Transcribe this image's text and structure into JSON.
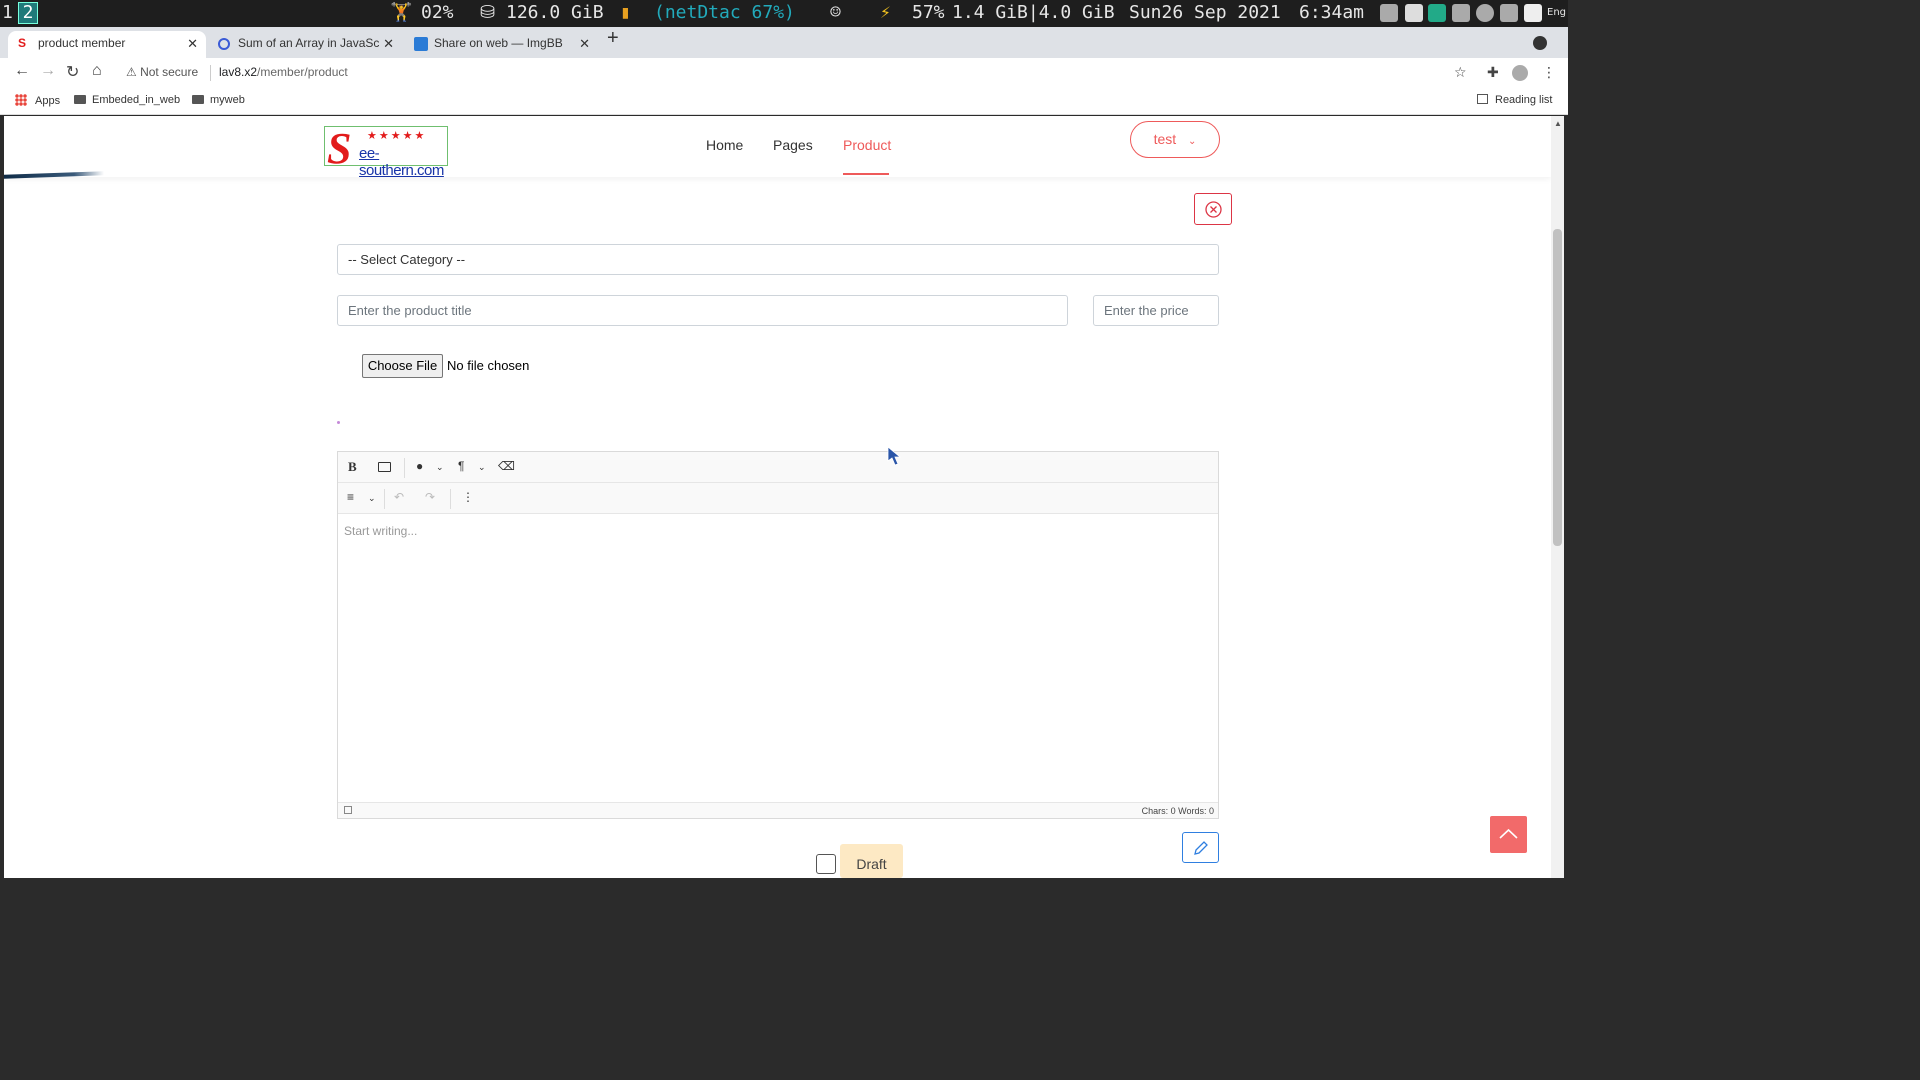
{
  "system_bar": {
    "workspace_1": "1",
    "workspace_2": "2",
    "cpu": "02%",
    "disk": "126.0 GiB",
    "wifi": "(netDtac  67%)",
    "battery": "57%",
    "memory": "1.4 GiB|4.0 GiB",
    "date": "Sun26 Sep 2021",
    "time": "6:34am",
    "lang": "Eng"
  },
  "tabs": [
    {
      "title": "product member",
      "active": true
    },
    {
      "title": "Sum of an Array in JavaScript",
      "active": false
    },
    {
      "title": "Share on web — ImgBB",
      "active": false
    }
  ],
  "address_bar": {
    "security": "Not secure",
    "host": "lav8.x2",
    "path": "/member/product"
  },
  "bookmarks": {
    "apps": "Apps",
    "items": [
      "Embeded_in_web",
      "myweb"
    ],
    "reading_list": "Reading list"
  },
  "site": {
    "logo_letter": "S",
    "logo_text": "ee-southern.com",
    "logo_stars": "★★★★★",
    "nav": [
      {
        "label": "Home",
        "active": false
      },
      {
        "label": "Pages",
        "active": false
      },
      {
        "label": "Product",
        "active": true
      }
    ],
    "user_label": "test",
    "accent_color": "#ee5a5a"
  },
  "form": {
    "category_select": "-- Select Category --",
    "title_placeholder": "Enter the product title",
    "price_placeholder": "Enter the price",
    "file_button": "Choose File",
    "file_status": "No file chosen",
    "editor_placeholder": "Start writing...",
    "editor_stats": "Chars: 0   Words: 0",
    "draft_label": "Draft"
  }
}
